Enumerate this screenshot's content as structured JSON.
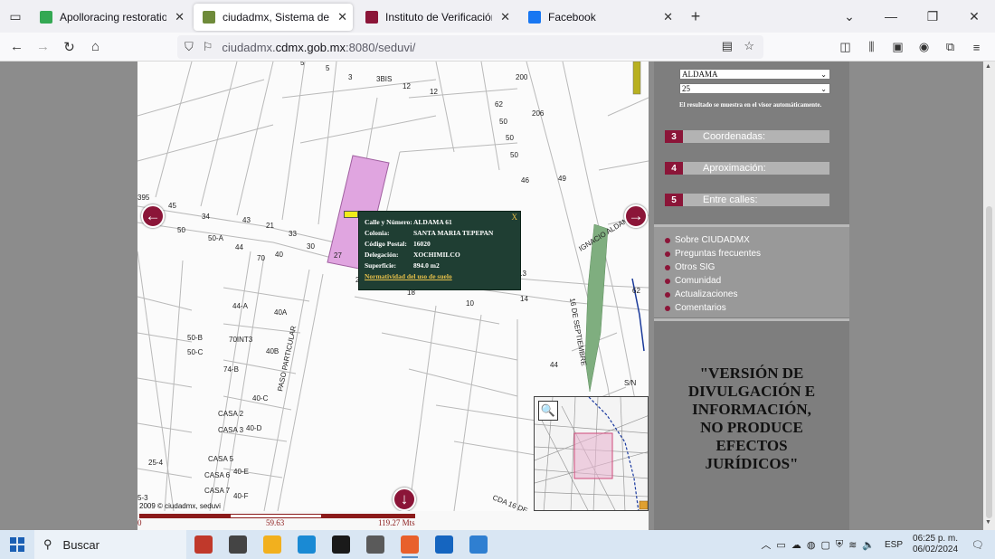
{
  "browser": {
    "tabs": [
      {
        "label": "Apolloracing restoration - Goo",
        "icon": "maps-pin-icon",
        "color": "#34a853",
        "active": false
      },
      {
        "label": "ciudadmx, Sistema de Informac",
        "icon": "site-icon",
        "color": "#6f8b3a",
        "active": true
      },
      {
        "label": "Instituto de Verificación Admin",
        "icon": "site-icon",
        "color": "#8b1538",
        "active": false
      },
      {
        "label": "Facebook",
        "icon": "facebook-icon",
        "color": "#1877f2",
        "active": false
      }
    ],
    "url_prefix": "ciudadmx.",
    "url_domain": "cdmx.gob.mx",
    "url_suffix": ":8080/seduvi/"
  },
  "map": {
    "street_numbers": [
      {
        "t": "5"
      },
      {
        "t": "5"
      },
      {
        "t": "3"
      },
      {
        "t": "3BIS"
      },
      {
        "t": "12"
      },
      {
        "t": "12"
      },
      {
        "t": "200"
      },
      {
        "t": "62"
      },
      {
        "t": "206"
      },
      {
        "t": "50"
      },
      {
        "t": "50"
      },
      {
        "t": "50"
      },
      {
        "t": "46"
      },
      {
        "t": "49"
      },
      {
        "t": "395"
      },
      {
        "t": "45"
      },
      {
        "t": "34"
      },
      {
        "t": "43"
      },
      {
        "t": "21"
      },
      {
        "t": "33"
      },
      {
        "t": "50"
      },
      {
        "t": "50-A"
      },
      {
        "t": "44"
      },
      {
        "t": "30"
      },
      {
        "t": "27"
      },
      {
        "t": "70"
      },
      {
        "t": "40"
      },
      {
        "t": "2"
      },
      {
        "t": "18"
      },
      {
        "t": "10"
      },
      {
        "t": "14"
      },
      {
        "t": "13"
      },
      {
        "t": "62"
      },
      {
        "t": "44-A"
      },
      {
        "t": "40A"
      },
      {
        "t": "50-B"
      },
      {
        "t": "70INT3"
      },
      {
        "t": "50-C"
      },
      {
        "t": "40B"
      },
      {
        "t": "74-B"
      },
      {
        "t": "44"
      },
      {
        "t": "S/N"
      },
      {
        "t": "40-C"
      },
      {
        "t": "CASA 2"
      },
      {
        "t": "40-D"
      },
      {
        "t": "CASA 3"
      },
      {
        "t": "25-4"
      },
      {
        "t": "CASA 5"
      },
      {
        "t": "40-E"
      },
      {
        "t": "CASA 6"
      },
      {
        "t": "CASA 7"
      },
      {
        "t": "40-F"
      },
      {
        "t": "5-3"
      }
    ],
    "street_names": {
      "particular": "PASO PARTICULAR",
      "septiembre": "16 DE SEPTIEMBRE",
      "aldama": "IGNACIO ALDAMA",
      "cda": "CDA 16 DE"
    },
    "copyright": "2009 © ciudadmx, seduvi",
    "scale": {
      "zero": "0",
      "mid": "59.63",
      "max": "119.27 Mts"
    },
    "popup": {
      "rows": [
        {
          "k": "Calle y Número:",
          "v": "ALDAMA 61"
        },
        {
          "k": "Colonia:",
          "v": "SANTA MARIA TEPEPAN"
        },
        {
          "k": "Código Postal:",
          "v": "16020"
        },
        {
          "k": "Delegación:",
          "v": "XOCHIMILCO"
        },
        {
          "k": "Superficie:",
          "v": "894.0 m2"
        }
      ],
      "link": "Normatividad del uso de suelo",
      "close": "X"
    }
  },
  "panel": {
    "select_street": "ALDAMA",
    "select_number": "25",
    "hint": "El resultado se muestra en el visor automáticamente.",
    "steps": [
      {
        "num": "3",
        "label": "Coordenadas:"
      },
      {
        "num": "4",
        "label": "Aproximación:"
      },
      {
        "num": "5",
        "label": "Entre calles:"
      }
    ],
    "links": [
      "Sobre CIUDADMX",
      "Preguntas frecuentes",
      "Otros SIG",
      "Comunidad",
      "Actualizaciones",
      "Comentarios"
    ],
    "notice": [
      "\"VERSIÓN DE",
      "DIVULGACIÓN E",
      "INFORMACIÓN,",
      "NO PRODUCE",
      "EFECTOS",
      "JURÍDICOS\""
    ]
  },
  "taskbar": {
    "search_label": "Buscar",
    "lang": "ESP",
    "time": "06:25 p. m.",
    "date": "06/02/2024",
    "apps": [
      {
        "name": "files-app",
        "color": "#c0392b"
      },
      {
        "name": "task-view",
        "color": "#444444"
      },
      {
        "name": "file-explorer",
        "color": "#f2b01e"
      },
      {
        "name": "edge-browser",
        "color": "#1a8ad4"
      },
      {
        "name": "dropbox",
        "color": "#1a1a1a"
      },
      {
        "name": "amazon",
        "color": "#5a5a5a"
      },
      {
        "name": "firefox",
        "color": "#e8602c"
      },
      {
        "name": "mail",
        "color": "#1565c0"
      },
      {
        "name": "photos",
        "color": "#2f7fd1"
      }
    ]
  }
}
